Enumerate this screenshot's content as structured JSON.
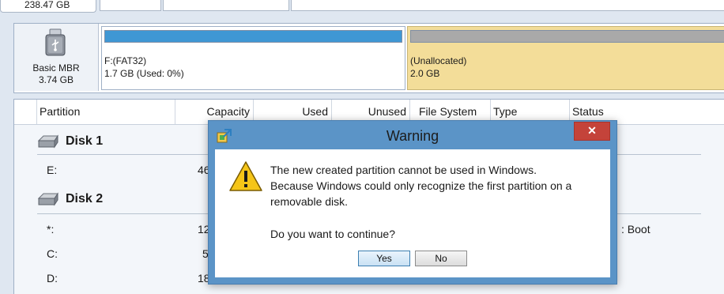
{
  "disk1_strip": {
    "size": "238.47 GB"
  },
  "disk2_strip": {
    "type": "Basic MBR",
    "size": "3.74 GB",
    "partitions": [
      {
        "name": "F:(FAT32)",
        "detail": "1.7 GB (Used: 0%)"
      },
      {
        "name": "(Unallocated)",
        "detail": "2.0 GB"
      }
    ]
  },
  "table": {
    "columns": [
      "Partition",
      "Capacity",
      "Used",
      "Unused",
      "File System",
      "Type",
      "Status"
    ],
    "groups": [
      {
        "label": "Disk 1",
        "rows": [
          {
            "partition": "E:",
            "capacity": "46"
          }
        ]
      },
      {
        "label": "Disk 2",
        "rows": [
          {
            "partition": "*:",
            "capacity": "12",
            "status": "Boot"
          },
          {
            "partition": "C:",
            "capacity": "5"
          },
          {
            "partition": "D:",
            "capacity": "18"
          }
        ]
      }
    ]
  },
  "dialog": {
    "title": "Warning",
    "close_glyph": "✕",
    "message_lines": [
      "The new created partition cannot be used in Windows.",
      "Because Windows could only recognize the first partition on a",
      "removable disk.",
      "Do you want to continue?"
    ],
    "yes_label": "Yes",
    "no_label": "No"
  },
  "icons": {
    "disk_strip": "usb-drive-icon",
    "group": "hard-disk-icon",
    "dialog_app": "app-icon",
    "dialog_message": "warning-icon"
  },
  "colors": {
    "partition_bar": "#3f97d4",
    "unallocated_bg": "#f3dd99",
    "dialog_frame": "#5b94c7",
    "close_button": "#c4433a"
  }
}
